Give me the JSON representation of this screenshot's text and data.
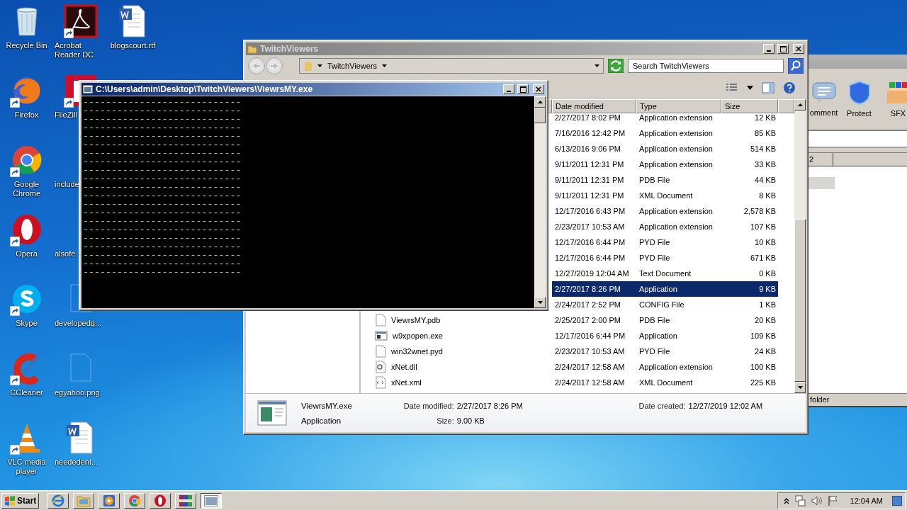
{
  "desktop": {
    "icon_columns": [
      {
        "items": [
          {
            "label": "Recycle Bin",
            "kind": "recycle",
            "shortcut": false
          },
          {
            "label": "Firefox",
            "kind": "firefox",
            "shortcut": true
          },
          {
            "label": "Google Chrome",
            "kind": "chrome",
            "shortcut": true
          },
          {
            "label": "Opera",
            "kind": "opera",
            "shortcut": true
          },
          {
            "label": "Skype",
            "kind": "skype",
            "shortcut": true
          },
          {
            "label": "CCleaner",
            "kind": "ccleaner",
            "shortcut": true
          },
          {
            "label": "VLC media player",
            "kind": "vlc",
            "shortcut": true
          }
        ]
      },
      {
        "items": [
          {
            "label": "Acrobat Reader DC",
            "kind": "acrobat",
            "shortcut": true
          },
          {
            "label": "FileZill",
            "kind": "filezilla",
            "shortcut": true
          },
          {
            "label": "include",
            "kind": "none",
            "shortcut": false
          },
          {
            "label": "alsofe",
            "kind": "none",
            "shortcut": false
          },
          {
            "label": "developedq...",
            "kind": "faint",
            "shortcut": false
          },
          {
            "label": "egyahoo.png",
            "kind": "faint",
            "shortcut": false
          },
          {
            "label": "neededent...",
            "kind": "word",
            "shortcut": false
          }
        ]
      },
      {
        "items": [
          {
            "label": "blogscourt.rtf",
            "kind": "word",
            "shortcut": false
          }
        ]
      }
    ]
  },
  "background_window": {
    "toolbar": [
      {
        "label": "omment",
        "kind": "comment"
      },
      {
        "label": "Protect",
        "kind": "protect"
      },
      {
        "label": "SFX",
        "kind": "sfx"
      }
    ],
    "column_header": "2",
    "status": "folder"
  },
  "explorer": {
    "title": "TwitchViewers",
    "address": "TwitchViewers",
    "search": {
      "placeholder": "Search TwitchViewers"
    },
    "columns": [
      "Date modified",
      "Type",
      "Size"
    ],
    "rows": [
      {
        "date": "2/27/2017 8:02 PM",
        "type": "Application extension",
        "size": "12 KB",
        "selected": false
      },
      {
        "date": "7/16/2016 12:42 PM",
        "type": "Application extension",
        "size": "85 KB",
        "selected": false
      },
      {
        "date": "6/13/2016 9:06 PM",
        "type": "Application extension",
        "size": "514 KB",
        "selected": false
      },
      {
        "date": "9/11/2011 12:31 PM",
        "type": "Application extension",
        "size": "33 KB",
        "selected": false
      },
      {
        "date": "9/11/2011 12:31 PM",
        "type": "PDB File",
        "size": "44 KB",
        "selected": false
      },
      {
        "date": "9/11/2011 12:31 PM",
        "type": "XML Document",
        "size": "8 KB",
        "selected": false
      },
      {
        "date": "12/17/2016 6:43 PM",
        "type": "Application extension",
        "size": "2,578 KB",
        "selected": false
      },
      {
        "date": "2/23/2017 10:53 AM",
        "type": "Application extension",
        "size": "107 KB",
        "selected": false
      },
      {
        "date": "12/17/2016 6:44 PM",
        "type": "PYD File",
        "size": "10 KB",
        "selected": false
      },
      {
        "date": "12/17/2016 6:44 PM",
        "type": "PYD File",
        "size": "671 KB",
        "selected": false
      },
      {
        "date": "12/27/2019 12:04 AM",
        "type": "Text Document",
        "size": "0 KB",
        "selected": false
      },
      {
        "date": "2/27/2017 8:26 PM",
        "type": "Application",
        "size": "9 KB",
        "selected": true
      },
      {
        "date": "2/24/2017 2:52 PM",
        "type": "CONFIG File",
        "size": "1 KB",
        "selected": false
      },
      {
        "name": "ViewrsMY.pdb",
        "kind": "blank",
        "date": "2/25/2017 2:00 PM",
        "type": "PDB File",
        "size": "20 KB",
        "selected": false
      },
      {
        "name": "w9xpopen.exe",
        "kind": "app",
        "date": "12/17/2016 6:44 PM",
        "type": "Application",
        "size": "109 KB",
        "selected": false
      },
      {
        "name": "win32wnet.pyd",
        "kind": "blank",
        "date": "2/23/2017 10:53 AM",
        "type": "PYD File",
        "size": "24 KB",
        "selected": false
      },
      {
        "name": "xNet.dll",
        "kind": "dll",
        "date": "2/24/2017 12:58 AM",
        "type": "Application extension",
        "size": "100 KB",
        "selected": false
      },
      {
        "name": "xNet.xml",
        "kind": "xml",
        "date": "2/24/2017 12:58 AM",
        "type": "XML Document",
        "size": "225 KB",
        "selected": false
      }
    ],
    "details": {
      "file_name": "ViewrsMY.exe",
      "file_type": "Application",
      "modified_label": "Date modified:",
      "modified": "2/27/2017 8:26 PM",
      "created_label": "Date created:",
      "created": "12/27/2019 12:02 AM",
      "size_label": "Size:",
      "size": "9.00 KB"
    }
  },
  "console": {
    "title": "C:\\Users\\admin\\Desktop\\TwitchViewers\\ViewrsMY.exe",
    "lines": [
      "----------------------------",
      "----------------------------",
      "----------------------------",
      "----------------------------",
      "----------------------------",
      "----------------------------",
      "----------------------------",
      "----------------------------",
      "----------------------------",
      "----------------------------",
      "----------------------------",
      "----------------------------",
      "----------------------------",
      "----------------------------",
      "----------------------------",
      "----------------------------",
      "----------------------------",
      "----------------------------",
      "----------------------------",
      "----------------------------",
      "----------------------------"
    ]
  },
  "taskbar": {
    "start": "Start",
    "buttons": [
      {
        "kind": "ie",
        "selected": false
      },
      {
        "kind": "folder",
        "selected": false
      },
      {
        "kind": "media",
        "selected": false
      },
      {
        "kind": "chrome",
        "selected": false
      },
      {
        "kind": "opera",
        "selected": false
      },
      {
        "kind": "winrar",
        "selected": false
      },
      {
        "kind": "console",
        "selected": true
      }
    ],
    "clock": "12:04 AM"
  }
}
